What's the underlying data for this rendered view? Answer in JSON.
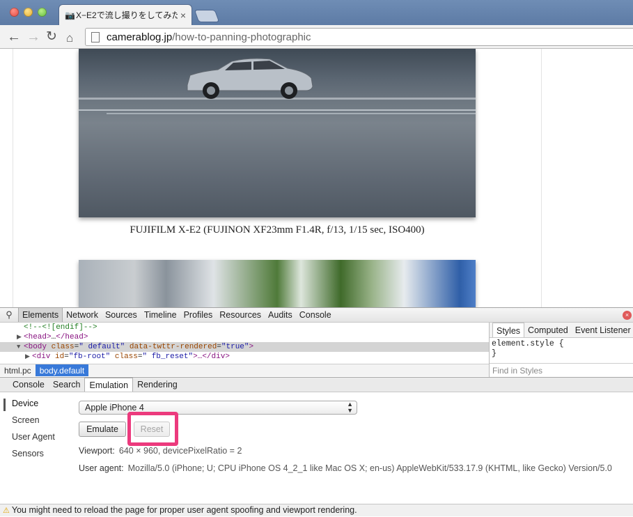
{
  "browser": {
    "tab_title": "X−E2で流し撮りをしてみた",
    "tab_close": "×",
    "url_host": "camerablog.jp",
    "url_path": "/how-to-panning-photographic"
  },
  "page": {
    "caption": "FUJIFILM X-E2 (FUJINON XF23mm F1.4R, f/13, 1/15 sec, ISO400)"
  },
  "devtools": {
    "tabs": [
      "Elements",
      "Network",
      "Sources",
      "Timeline",
      "Profiles",
      "Resources",
      "Audits",
      "Console"
    ],
    "dom": {
      "comment": "<!--<![endif]-->",
      "head_open": "<head>",
      "head_ellipsis": "…",
      "head_close": "</head>",
      "body_tag": "body",
      "body_attr1": "class",
      "body_val1": "\" default\"",
      "body_attr2": "data-twttr-rendered",
      "body_val2": "\"true\"",
      "div_tag": "div",
      "div_attr1": "id",
      "div_val1": "\"fb-root\"",
      "div_attr2": "class",
      "div_val2": "\" fb_reset\"",
      "div_rest": "…</div>"
    },
    "breadcrumbs": [
      "html.pc",
      "body.default"
    ],
    "styles_tabs": [
      "Styles",
      "Computed",
      "Event Listener"
    ],
    "styles_rule_open": "element.style {",
    "styles_rule_close": "}",
    "styles_find_placeholder": "Find in Styles",
    "drawer_tabs": [
      "Console",
      "Search",
      "Emulation",
      "Rendering"
    ],
    "emulation": {
      "side_items": [
        "Device",
        "Screen",
        "User Agent",
        "Sensors"
      ],
      "device_selected": "Apple iPhone 4",
      "emulate_label": "Emulate",
      "reset_label": "Reset",
      "viewport_label": "Viewport:",
      "viewport_value": "640 × 960, devicePixelRatio = 2",
      "ua_label": "User agent:",
      "ua_value": "Mozilla/5.0 (iPhone; U; CPU iPhone OS 4_2_1 like Mac OS X; en-us) AppleWebKit/533.17.9 (KHTML, like Gecko) Version/5.0"
    },
    "status_message": "You might need to reload the page for proper user agent spoofing and viewport rendering."
  },
  "colors": {
    "highlight": "#ec3a7d",
    "selected_crumb": "#3879d9"
  }
}
